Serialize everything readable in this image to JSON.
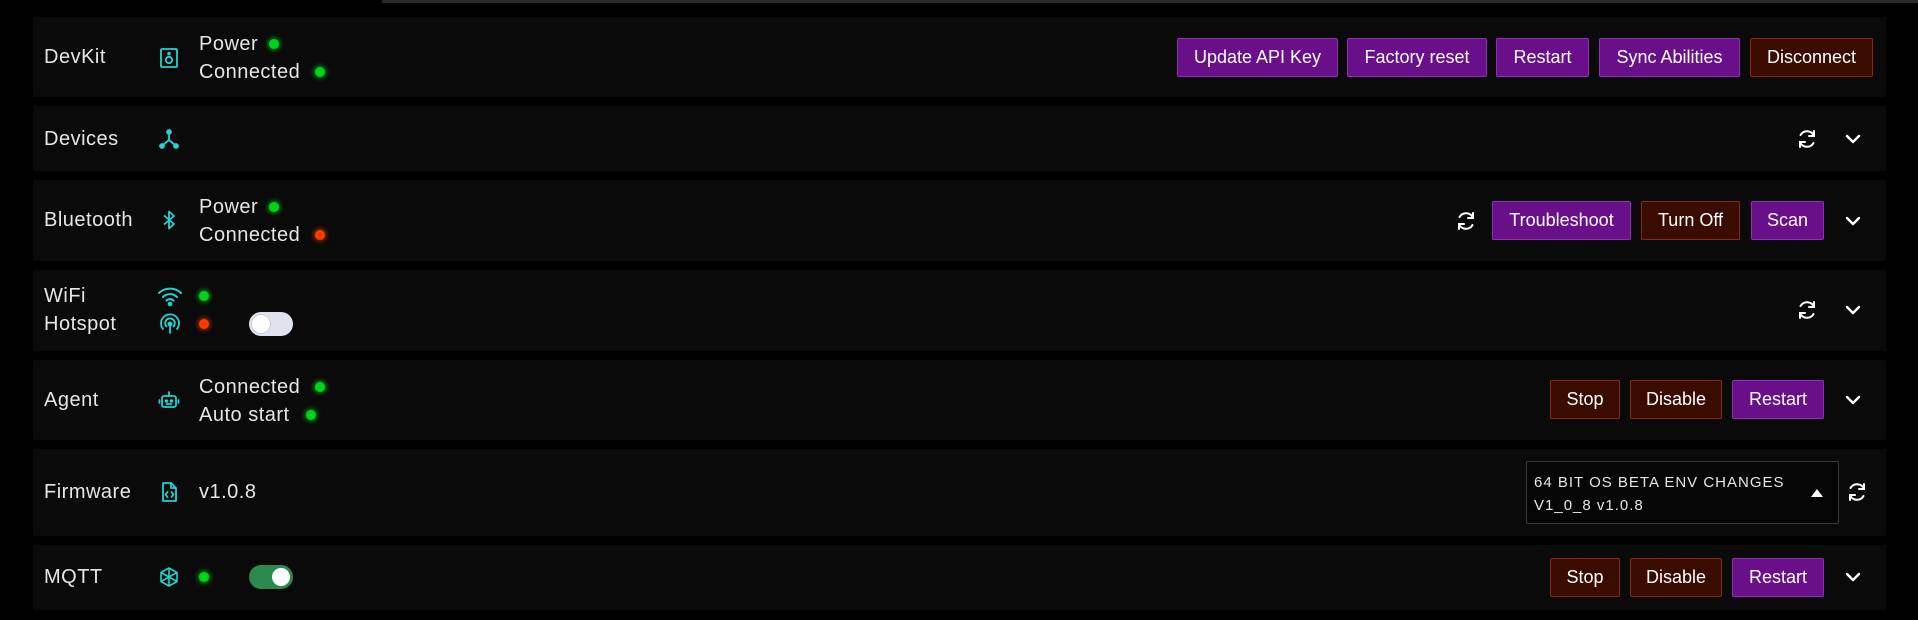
{
  "devkit": {
    "label": "DevKit",
    "power_label": "Power",
    "connected_label": "Connected",
    "buttons": {
      "update_api_key": "Update API Key",
      "factory_reset": "Factory reset",
      "restart": "Restart",
      "sync_abilities": "Sync Abilities",
      "disconnect": "Disconnect"
    }
  },
  "devices": {
    "label": "Devices"
  },
  "bluetooth": {
    "label": "Bluetooth",
    "power_label": "Power",
    "connected_label": "Connected",
    "buttons": {
      "troubleshoot": "Troubleshoot",
      "turn_off": "Turn Off",
      "scan": "Scan"
    }
  },
  "wifi": {
    "wifi_label": "WiFi",
    "hotspot_label": "Hotspot"
  },
  "agent": {
    "label": "Agent",
    "connected_label": "Connected",
    "autostart_label": "Auto start",
    "buttons": {
      "stop": "Stop",
      "disable": "Disable",
      "restart": "Restart"
    }
  },
  "firmware": {
    "label": "Firmware",
    "version": "v1.0.8",
    "select_line1": "64 BIT OS BETA ENV CHANGES",
    "select_line2": "V1_0_8 v1.0.8"
  },
  "mqtt": {
    "label": "MQTT",
    "buttons": {
      "stop": "Stop",
      "disable": "Disable",
      "restart": "Restart"
    }
  },
  "colors": {
    "accent": "#22d3d3",
    "status_on": "#00d21a",
    "status_off": "#ff3a00",
    "button_purple": "#6a0f8a",
    "button_brown": "#3a0c00"
  },
  "icons": {
    "devkit": "speaker-icon",
    "devices": "network-icon",
    "bluetooth": "bluetooth-icon",
    "wifi": "wifi-icon",
    "hotspot": "hotspot-icon",
    "agent": "robot-icon",
    "firmware": "file-code-icon",
    "mqtt": "mqtt-icon",
    "refresh": "refresh-icon",
    "expand": "chevron-down-icon"
  }
}
